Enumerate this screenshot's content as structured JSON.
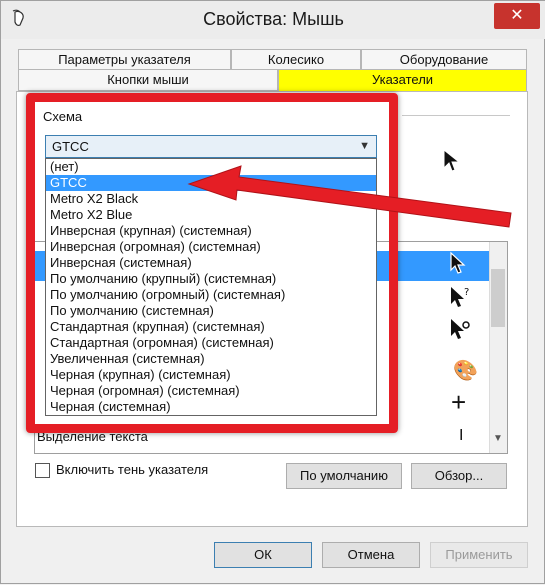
{
  "window": {
    "title": "Свойства: Мышь",
    "close_glyph": "✕"
  },
  "tabs_row1": [
    {
      "label": "Параметры указателя"
    },
    {
      "label": "Колесико"
    },
    {
      "label": "Оборудование"
    }
  ],
  "tabs_row2": [
    {
      "label": "Кнопки мыши"
    },
    {
      "label": "Указатели",
      "active": true
    }
  ],
  "scheme": {
    "label": "Схема",
    "selected": "GTCC",
    "options": [
      "(нет)",
      "GTCC",
      "Metro X2 Black",
      "Metro X2 Blue",
      "Инверсная (крупная) (системная)",
      "Инверсная (огромная) (системная)",
      "Инверсная (системная)",
      "По умолчанию (крупный) (системная)",
      "По умолчанию (огромный) (системная)",
      "По умолчанию (системная)",
      "Стандартная (крупная) (системная)",
      "Стандартная (огромная) (системная)",
      "Увеличенная (системная)",
      "Черная (крупная) (системная)",
      "Черная (огромная) (системная)",
      "Черная (системная)"
    ],
    "selected_index": 1
  },
  "cursor_list": {
    "last_visible_row": "Выделение текста"
  },
  "shadow_checkbox": {
    "label": "Включить тень указателя",
    "checked": false
  },
  "buttons": {
    "default": "По умолчанию",
    "browse": "Обзор...",
    "ok": "ОК",
    "cancel": "Отмена",
    "apply": "Применить"
  },
  "annotation_colors": {
    "highlight_frame": "#e51e25",
    "active_tab": "#ffff00",
    "selection": "#3399ff"
  }
}
